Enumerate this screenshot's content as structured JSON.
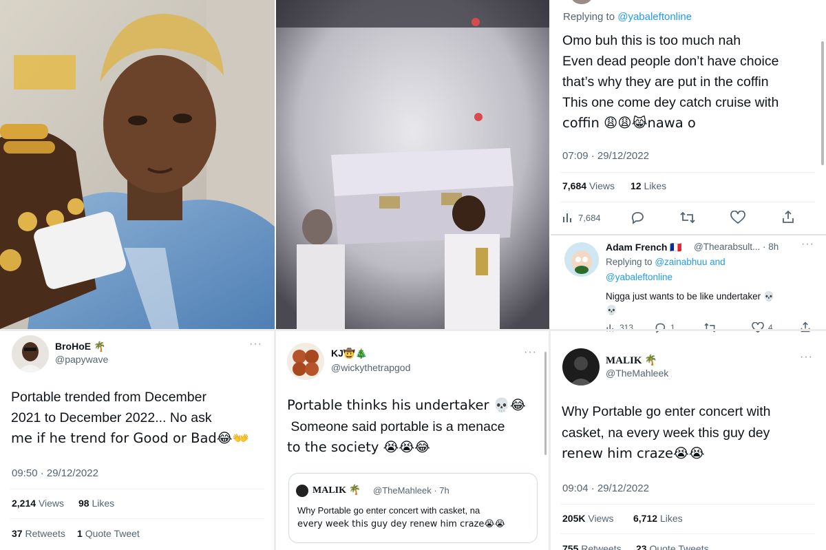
{
  "tweet_top_right": {
    "replying_prefix": "Replying to",
    "replying_to": "@yabaleftonline",
    "text_lines": [
      "Omo buh this is too much nah",
      "Even dead people don’t have choice",
      "that’s why they are put in the coffin",
      "This one come dey catch cruise with",
      "coffin 😩😩😹nawa o"
    ],
    "timestamp": "07:09 · 29/12/2022",
    "views_count": "7,684",
    "views_label": "Views",
    "likes_count": "12",
    "likes_label": "Likes",
    "action_views": "7,684"
  },
  "tweet_adam": {
    "name": "Adam French 🇫🇷",
    "handle_time": "@Thearabsult... · 8h",
    "replying_prefix": "Replying to",
    "replying_to_line1": "@zainabhuu and",
    "replying_to_line2": "@yabaleftonline",
    "text_line1": "Nigga just wants to be like undertaker 💀",
    "text_line2": "💀",
    "views": "313",
    "replies": "1",
    "likes": "4"
  },
  "tweet_brohoe": {
    "name": "BroHoE 🌴",
    "handle": "@papywave",
    "text_lines": [
      "Portable trended from December",
      "2021 to December 2022... No ask",
      "me if he trend for Good or Bad😂👐"
    ],
    "timestamp": "09:50 · 29/12/2022",
    "views_count": "2,214",
    "views_label": "Views",
    "likes_count": "98",
    "likes_label": "Likes",
    "retweets_count": "37",
    "retweets_label": "Retweets",
    "quotes_count": "1",
    "quotes_label": "Quote Tweet"
  },
  "tweet_kj": {
    "name": "KJ🤠🎄",
    "handle": "@wickythetrapgod",
    "text_lines": [
      "Portable thinks his undertaker 💀😂",
      " Someone said portable is a menace",
      "to the society 😭😭😂"
    ],
    "quote": {
      "name": "MALIK 🌴",
      "handle_time": "@TheMahleek · 7h",
      "text_lines": [
        "Why Portable go enter concert with casket, na",
        "every week this guy dey renew him craze😭😭"
      ]
    }
  },
  "tweet_malik": {
    "name": "MALIK 🌴",
    "handle": "@TheMahleek",
    "text_lines": [
      "Why Portable go enter concert with",
      "casket, na every week this guy dey",
      "renew him craze😭😭"
    ],
    "timestamp": "09:04 · 29/12/2022",
    "views_count": "205K",
    "views_label": "Views",
    "likes_count": "6,712",
    "likes_label": "Likes",
    "retweets_count": "755",
    "retweets_label": "Retweets",
    "quotes_count": "23",
    "quotes_label": "Quote Tweets"
  },
  "icons": {
    "more": "···",
    "views": "bar-chart-icon",
    "reply": "speech-bubble-icon",
    "retweet": "retweet-icon",
    "like": "heart-icon",
    "share": "share-icon"
  },
  "colors": {
    "link": "#1d9bf0",
    "text": "#0f1419",
    "secondary": "#536471"
  }
}
